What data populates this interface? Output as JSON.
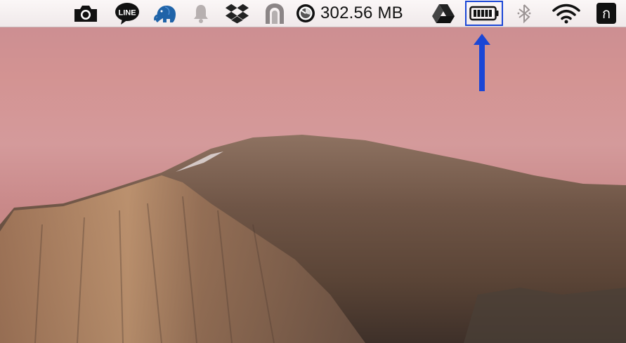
{
  "menubar": {
    "memory_readout": "302.56 MB",
    "line_icon_text": "LINE",
    "app_glyph": "ก",
    "icons": [
      "camera-icon",
      "line-icon",
      "evernote-elephant-icon",
      "notification-bell-icon",
      "dropbox-icon",
      "arch-app-icon",
      "memory-gauge-icon",
      "google-drive-icon",
      "battery-icon",
      "bluetooth-icon",
      "wifi-icon",
      "input-source-icon"
    ]
  },
  "annotation": {
    "highlight_target": "battery-icon",
    "arrow_color": "#1a46d6"
  },
  "colors": {
    "menubar": "#f4eeef",
    "sky": "#d39392",
    "rock": "#8a6a55"
  }
}
